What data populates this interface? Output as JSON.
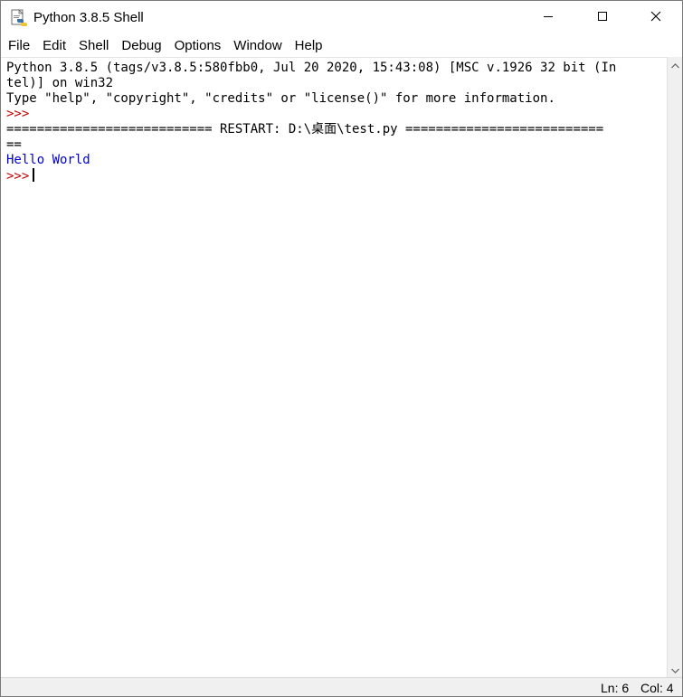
{
  "window": {
    "title": "Python 3.8.5 Shell",
    "icon": "python-idle-icon",
    "controls": {
      "minimize_icon": "minimize-icon",
      "maximize_icon": "maximize-icon",
      "close_icon": "close-icon"
    }
  },
  "menubar": {
    "items": [
      {
        "label": "File"
      },
      {
        "label": "Edit"
      },
      {
        "label": "Shell"
      },
      {
        "label": "Debug"
      },
      {
        "label": "Options"
      },
      {
        "label": "Window"
      },
      {
        "label": "Help"
      }
    ]
  },
  "shell": {
    "lines": [
      "Python 3.8.5 (tags/v3.8.5:580fbb0, Jul 20 2020, 15:43:08) [MSC v.1926 32 bit (In",
      "tel)] on win32",
      "Type \"help\", \"copyright\", \"credits\" or \"license()\" for more information.",
      ">>>",
      "=========================== RESTART: D:\\桌面\\test.py ==========================",
      "==",
      "Hello World",
      ">>>"
    ]
  },
  "statusbar": {
    "ln": "Ln: 6",
    "col": "Col: 4"
  },
  "colors": {
    "prompt": "#c00000",
    "stdout": "#0000d0",
    "text": "#000000",
    "background": "#ffffff"
  }
}
